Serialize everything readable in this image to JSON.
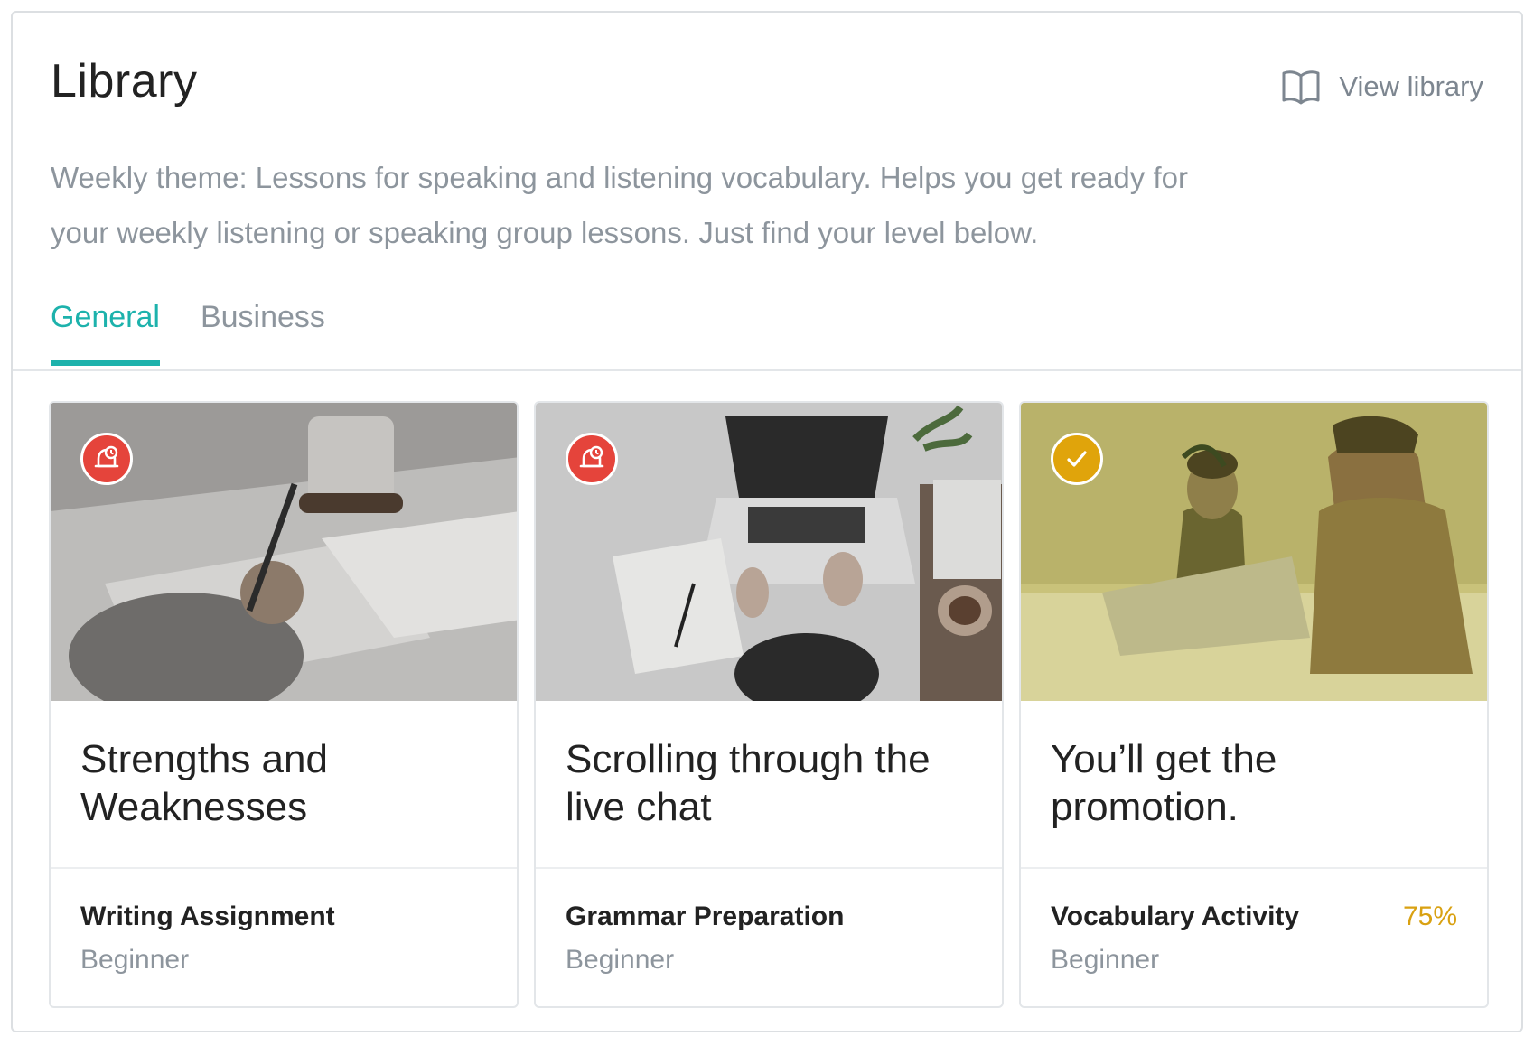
{
  "header": {
    "title": "Library",
    "view_library_label": "View library",
    "description": "Weekly theme: Lessons for speaking and listening vocabulary. Helps you get ready for your weekly listening or speaking group lessons. Just find your level below."
  },
  "tabs": [
    {
      "label": "General",
      "active": true
    },
    {
      "label": "Business",
      "active": false
    }
  ],
  "colors": {
    "accent": "#1db2ac",
    "alert": "#e5443b",
    "complete": "#e0a40b",
    "progress_text": "#d9a112"
  },
  "cards": [
    {
      "title": "Strengths and Weaknesses",
      "type": "Writing Assignment",
      "level": "Beginner",
      "status_icon": "alarm-bell-icon",
      "progress": ""
    },
    {
      "title": "Scrolling through the live chat",
      "type": "Grammar Preparation",
      "level": "Beginner",
      "status_icon": "alarm-bell-icon",
      "progress": ""
    },
    {
      "title": "You’ll get the promotion.",
      "type": "Vocabulary Activity",
      "level": "Beginner",
      "status_icon": "checkmark-icon",
      "progress": "75%"
    }
  ]
}
